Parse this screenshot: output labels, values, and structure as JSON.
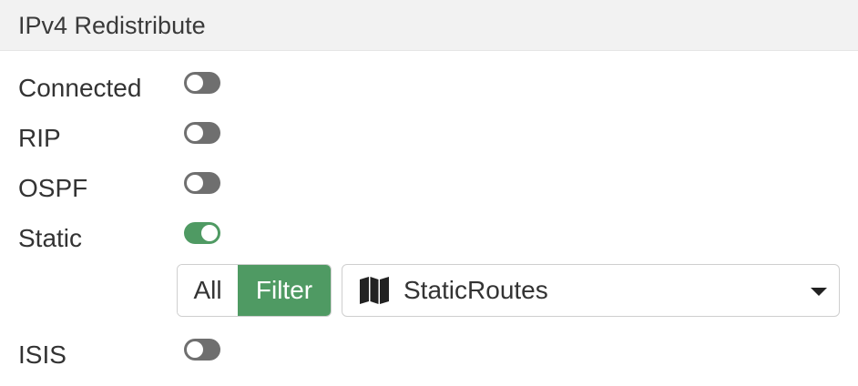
{
  "section": {
    "title": "IPv4 Redistribute"
  },
  "protocols": [
    {
      "label": "Connected",
      "enabled": false
    },
    {
      "label": "RIP",
      "enabled": false
    },
    {
      "label": "OSPF",
      "enabled": false
    },
    {
      "label": "Static",
      "enabled": true
    },
    {
      "label": "ISIS",
      "enabled": false
    }
  ],
  "static_filter": {
    "segments": [
      "All",
      "Filter"
    ],
    "selected_segment": "Filter",
    "route_map_icon": "map-icon",
    "route_map_value": "StaticRoutes",
    "dropdown_icon": "caret-down-icon"
  },
  "colors": {
    "accent_green": "#4f9a63",
    "toggle_off": "#6f6f6f",
    "header_bg": "#f2f2f2"
  }
}
